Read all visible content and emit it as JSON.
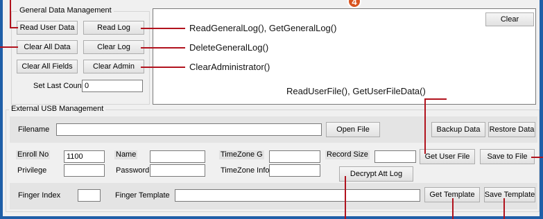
{
  "general": {
    "title": "General Data Management",
    "read_user_data": "Read User Data",
    "read_log": "Read Log",
    "clear_all_data": "Clear All Data",
    "clear_log": "Clear Log",
    "clear_all_fields": "Clear All Fields",
    "clear_admin": "Clear Admin",
    "set_last_count_label": "Set Last Count",
    "set_last_count_value": "0",
    "clear_button": "Clear"
  },
  "usb": {
    "title": "External USB Management",
    "filename_label": "Filename",
    "filename_value": "",
    "open_file": "Open File",
    "backup_data": "Backup Data",
    "restore_data": "Restore Data",
    "enroll_no_label": "Enroll No",
    "enroll_no_value": "1100",
    "name_label": "Name",
    "timezone_g_label": "TimeZone G",
    "record_size_label": "Record Size",
    "get_user_file": "Get User File",
    "save_to_file": "Save to File",
    "privilege_label": "Privilege",
    "password_label": "Password",
    "timezone_info_label": "TimeZone Info",
    "decrypt_att_log": "Decrypt Att Log",
    "finger_index_label": "Finger Index",
    "finger_template_label": "Finger Template",
    "get_template": "Get Template",
    "save_template": "Save Template"
  },
  "annotations": {
    "read_log": "ReadGeneralLog(), GetGeneralLog()",
    "clear_log": "DeleteGeneralLog()",
    "clear_admin": "ClearAdministrator()",
    "get_user_file": "ReadUserFile(), GetUserFileData()",
    "badge": "4"
  },
  "colors": {
    "annotation_line": "#b1121d",
    "badge": "#d9531e",
    "window_frame": "#1f5fa8"
  }
}
